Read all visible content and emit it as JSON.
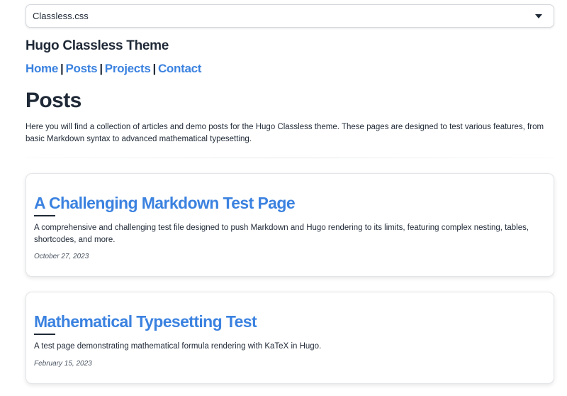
{
  "theme_selector": {
    "selected": "Classless.css"
  },
  "site": {
    "title": "Hugo Classless Theme"
  },
  "nav": {
    "items": [
      {
        "label": "Home"
      },
      {
        "label": "Posts"
      },
      {
        "label": "Projects"
      },
      {
        "label": "Contact"
      }
    ],
    "separator": "|"
  },
  "main": {
    "title": "Posts",
    "intro": "Here you will find a collection of articles and demo posts for the Hugo Classless theme. These pages are designed to test various features, from basic Markdown syntax to advanced mathematical typesetting."
  },
  "posts": [
    {
      "title": "A Challenging Markdown Test Page",
      "summary": "A comprehensive and challenging test file designed to push Markdown and Hugo rendering to its limits, featuring complex nesting, tables, shortcodes, and more.",
      "date": "October 27, 2023"
    },
    {
      "title": "Mathematical Typesetting Test",
      "summary": "A test page demonstrating mathematical formula rendering with KaTeX in Hugo.",
      "date": "February 15, 2023"
    }
  ],
  "colors": {
    "link": "#3b82e0",
    "text": "#1f2937",
    "muted": "#4b5563"
  }
}
